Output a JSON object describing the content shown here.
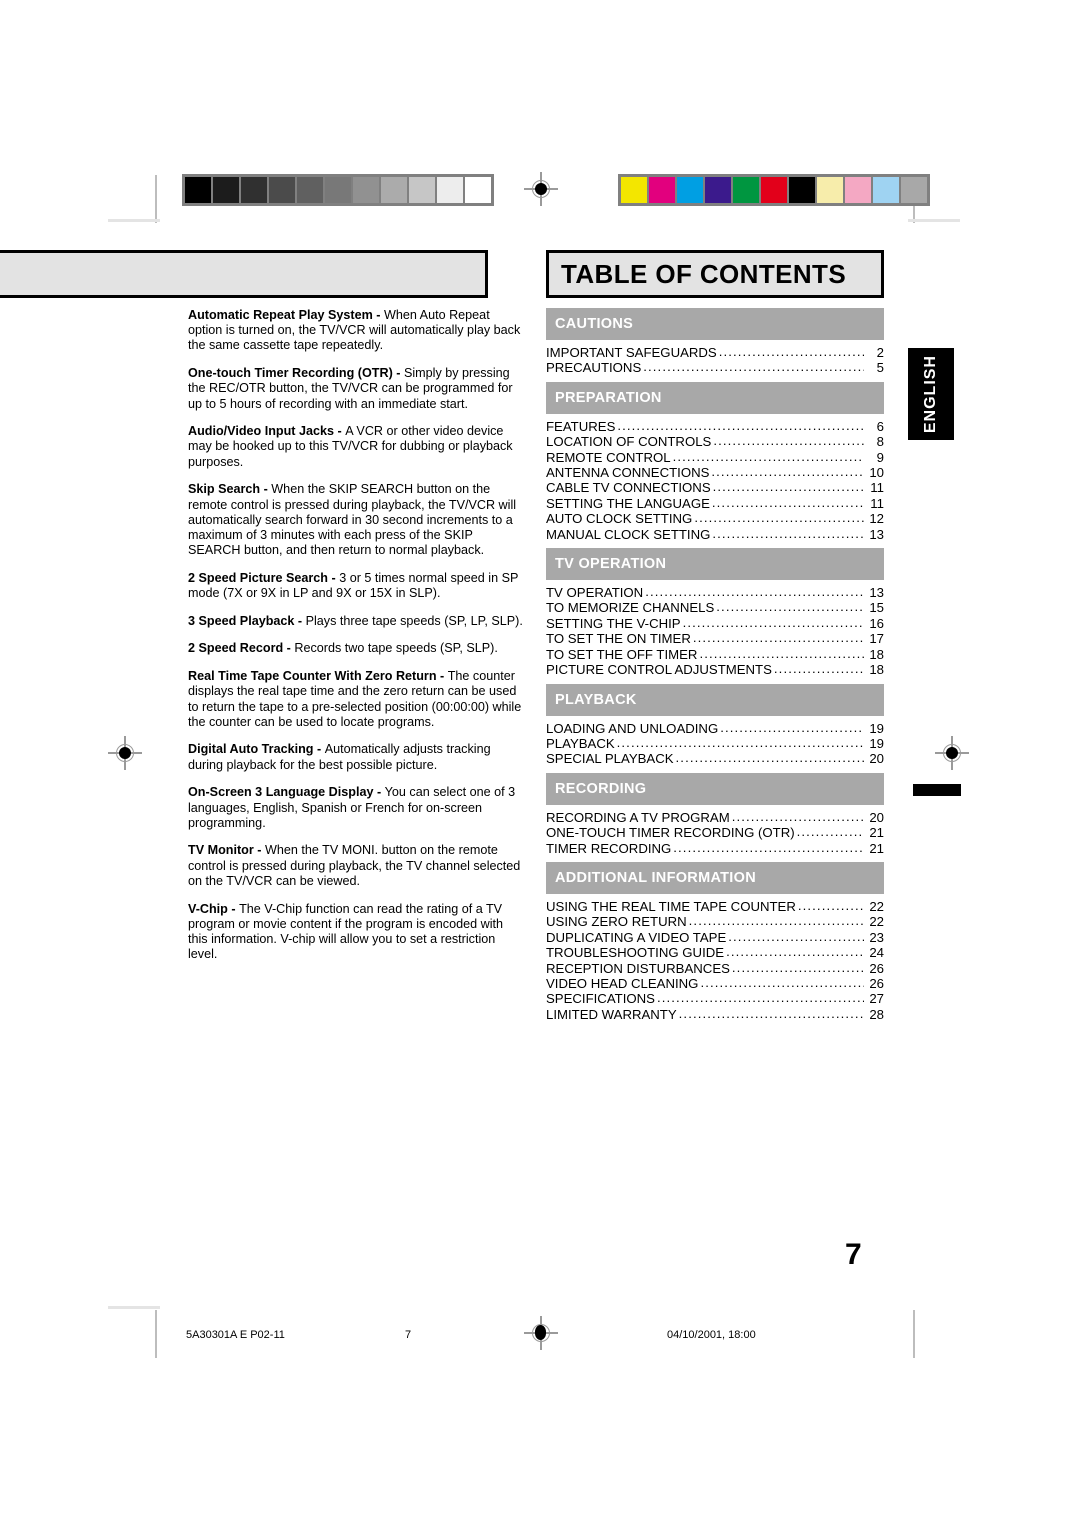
{
  "document": {
    "page_number": "7",
    "language_tab": "ENGLISH"
  },
  "calibration": {
    "gray_strip": {
      "name": "grayscale-calibration-strip",
      "swatches": [
        "#000000",
        "#1c1c1c",
        "#303030",
        "#4b4b4b",
        "#606060",
        "#787878",
        "#919191",
        "#ababab",
        "#c6c6c6",
        "#ededed",
        "#ffffff"
      ]
    },
    "color_strip": {
      "name": "color-calibration-strip",
      "swatches": [
        "#f3e600",
        "#e2007e",
        "#009fe3",
        "#3b1a8c",
        "#009640",
        "#e2001a",
        "#000000",
        "#f7edab",
        "#f4a8c3",
        "#9fd3f2",
        "#a8a8a8"
      ]
    }
  },
  "features": {
    "title_box_label": "",
    "items": [
      {
        "lead": "Automatic Repeat Play System - ",
        "text": "When Auto Repeat option is turned on, the TV/VCR will automatically play back the same cassette tape repeatedly."
      },
      {
        "lead": "One-touch Timer Recording (OTR) - ",
        "text": "Simply by pressing the REC/OTR button, the TV/VCR can be programmed for up to 5 hours of recording with an immediate start."
      },
      {
        "lead": "Audio/Video Input Jacks - ",
        "text": "A VCR or other video device may be hooked up to this TV/VCR for dubbing or playback purposes."
      },
      {
        "lead": "Skip Search - ",
        "text": "When the SKIP SEARCH button on the remote control is pressed during playback, the TV/VCR will automatically search forward in 30 second increments to a maximum of 3 minutes with each press of the SKIP SEARCH button, and then return to normal playback."
      },
      {
        "lead": "2 Speed Picture Search - ",
        "text": "3 or 5 times normal speed in SP mode (7X or 9X in LP and 9X or 15X in SLP)."
      },
      {
        "lead": "3 Speed Playback - ",
        "text": "Plays three tape speeds (SP, LP, SLP)."
      },
      {
        "lead": "2 Speed Record - ",
        "text": "Records two tape speeds (SP, SLP)."
      },
      {
        "lead": "Real Time Tape Counter With Zero Return - ",
        "text": "The counter displays the real tape time and the zero return can be used to return the tape to a pre-selected position (00:00:00) while the counter can be used to locate programs."
      },
      {
        "lead": "Digital Auto Tracking - ",
        "text": "Automatically adjusts tracking during playback for the best possible picture."
      },
      {
        "lead": "On-Screen 3 Language Display - ",
        "text": "You can select one of 3 languages, English, Spanish or French for on-screen programming."
      },
      {
        "lead": "TV Monitor - ",
        "text": "When the TV MONI. button on the remote control is pressed during playback, the TV channel selected on the TV/VCR can be viewed."
      },
      {
        "lead": "V-Chip - ",
        "text": "The V-Chip function can read the rating of a TV program or movie content if the program is encoded with this information. V-chip will allow you to set a restriction level."
      }
    ]
  },
  "toc": {
    "title": "TABLE OF CONTENTS",
    "section_header_color": "#a8a8a8",
    "sections": [
      {
        "heading": "CAUTIONS",
        "entries": [
          {
            "label": "IMPORTANT SAFEGUARDS",
            "page": "2"
          },
          {
            "label": "PRECAUTIONS",
            "page": "5"
          }
        ]
      },
      {
        "heading": "PREPARATION",
        "entries": [
          {
            "label": "FEATURES",
            "page": "6"
          },
          {
            "label": "LOCATION OF CONTROLS",
            "page": "8"
          },
          {
            "label": "REMOTE CONTROL",
            "page": "9"
          },
          {
            "label": "ANTENNA CONNECTIONS",
            "page": "10"
          },
          {
            "label": "CABLE TV CONNECTIONS",
            "page": "11"
          },
          {
            "label": "SETTING THE LANGUAGE",
            "page": "11"
          },
          {
            "label": "AUTO CLOCK SETTING",
            "page": "12"
          },
          {
            "label": "MANUAL CLOCK SETTING",
            "page": "13"
          }
        ]
      },
      {
        "heading": "TV OPERATION",
        "entries": [
          {
            "label": "TV OPERATION",
            "page": "13"
          },
          {
            "label": "TO MEMORIZE CHANNELS",
            "page": "15"
          },
          {
            "label": "SETTING THE V-CHIP",
            "page": "16"
          },
          {
            "label": "TO SET THE ON TIMER",
            "page": "17"
          },
          {
            "label": "TO SET THE OFF TIMER",
            "page": "18"
          },
          {
            "label": "PICTURE CONTROL ADJUSTMENTS",
            "page": "18"
          }
        ]
      },
      {
        "heading": "PLAYBACK",
        "entries": [
          {
            "label": "LOADING AND UNLOADING",
            "page": "19"
          },
          {
            "label": "PLAYBACK",
            "page": "19"
          },
          {
            "label": "SPECIAL PLAYBACK",
            "page": "20"
          }
        ]
      },
      {
        "heading": "RECORDING",
        "entries": [
          {
            "label": "RECORDING A TV PROGRAM",
            "page": "20"
          },
          {
            "label": "ONE-TOUCH TIMER RECORDING (OTR)",
            "page": "21"
          },
          {
            "label": "TIMER RECORDING",
            "page": "21"
          }
        ]
      },
      {
        "heading": "ADDITIONAL INFORMATION",
        "entries": [
          {
            "label": "USING THE REAL TIME TAPE COUNTER",
            "page": "22"
          },
          {
            "label": "USING ZERO RETURN",
            "page": "22"
          },
          {
            "label": "DUPLICATING A VIDEO TAPE",
            "page": "23"
          },
          {
            "label": "TROUBLESHOOTING GUIDE",
            "page": "24"
          },
          {
            "label": "RECEPTION DISTURBANCES",
            "page": "26"
          },
          {
            "label": "VIDEO HEAD CLEANING",
            "page": "26"
          },
          {
            "label": "SPECIFICATIONS",
            "page": "27"
          },
          {
            "label": "LIMITED WARRANTY",
            "page": "28"
          }
        ]
      }
    ]
  },
  "footer": {
    "document_code": "5A30301A E P02-11",
    "page": "7",
    "timestamp": "04/10/2001, 18:00"
  }
}
